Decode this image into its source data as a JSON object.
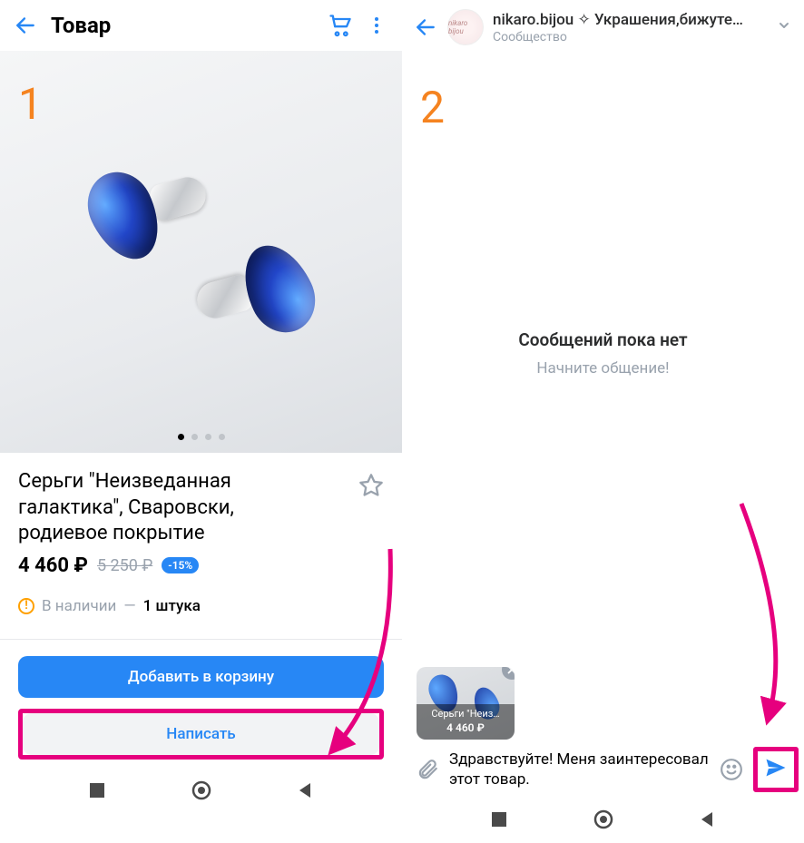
{
  "screen1": {
    "step_number": "1",
    "header_title": "Товар",
    "product_title": "Серьги \"Неизведанная галактика\", Сваровски, родиевое покрытие",
    "price": "4 460 ₽",
    "old_price": "5 250 ₽",
    "discount": "-15%",
    "stock_label": "В наличии",
    "stock_dash": "—",
    "stock_qty": "1 штука",
    "add_to_cart": "Добавить в корзину",
    "write": "Написать",
    "carousel_count": 4,
    "carousel_active": 0
  },
  "screen2": {
    "step_number": "2",
    "chat_title": "nikaro.bijou ✧ Украшения,бижуте…",
    "chat_subtitle": "Сообщество",
    "avatar_text": "nikaro bijou",
    "empty_title": "Сообщений пока нет",
    "empty_subtitle": "Начните общение!",
    "attachment_name": "Серьги \"Неиз…",
    "attachment_price": "4 460 ₽",
    "message_text": "Здравствуйте! Меня заинтересовал этот товар."
  },
  "colors": {
    "accent": "#2787f5",
    "highlight": "#e6007e",
    "step": "#f58320"
  }
}
